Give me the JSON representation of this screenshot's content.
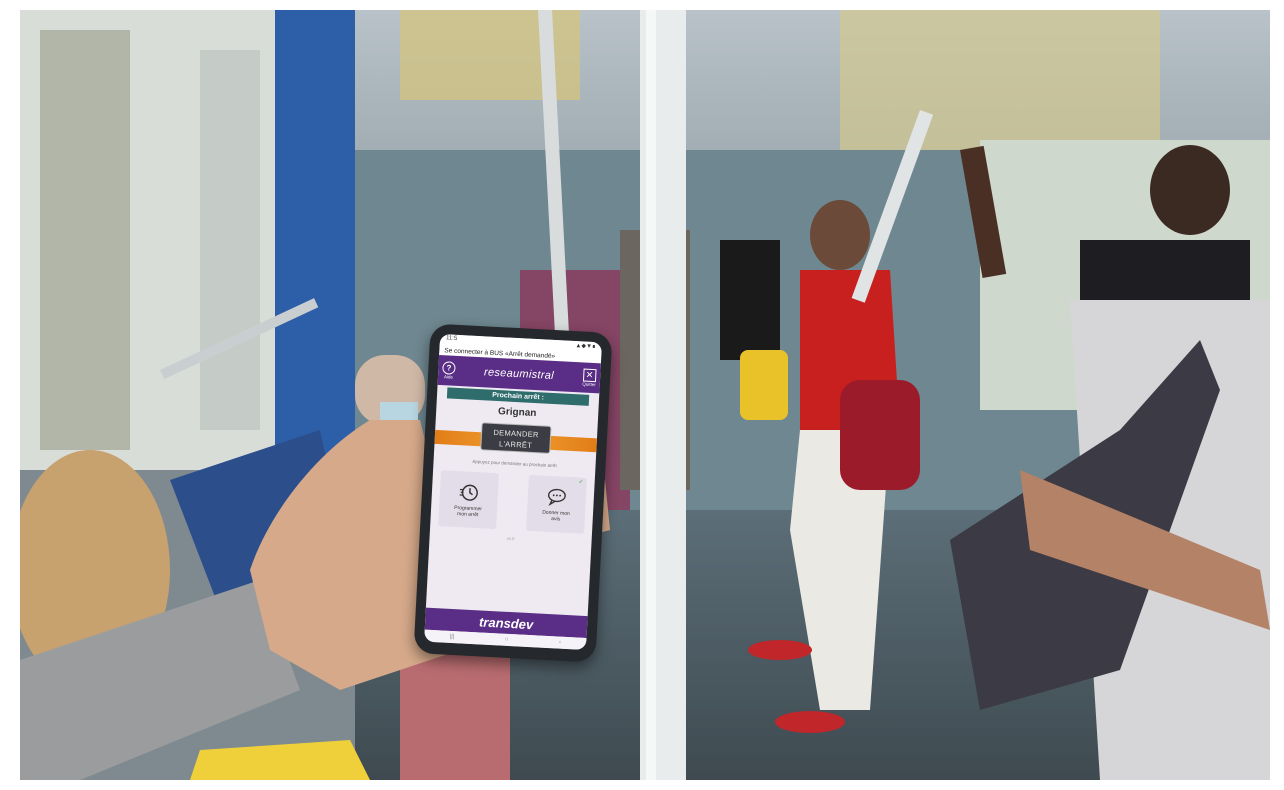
{
  "image": {
    "description_free": true
  },
  "phone": {
    "status_time": "11:5",
    "status_icons": "▲◆▼∎",
    "connection_text": "Se connecter à BUS «Arrêt demandé»",
    "help_label": "Aide",
    "help_symbol": "?",
    "close_label": "Quitter",
    "close_symbol": "✕",
    "app_logo": "reseaumistral",
    "next_stop_label": "Prochain arrêt :",
    "stop_name": "Grignan",
    "request_line1": "DEMANDER",
    "request_line2": "L'ARRÊT",
    "hint_text": "Appuyez pour demander au prochain arrêt",
    "tile_program_label_1": "Programmer",
    "tile_program_label_2": "mon arrêt",
    "tile_opinion_label_1": "Donner mon",
    "tile_opinion_label_2": "avis",
    "tile_opinion_check": "✓",
    "version_text": "v1.0",
    "brand": "transdev",
    "nav_back": "‹",
    "nav_home": "○",
    "nav_recent": "|||"
  },
  "colors": {
    "app_purple": "#5a2d86",
    "prochain_teal": "#2f6c6c",
    "request_orange": "#e27d18"
  }
}
